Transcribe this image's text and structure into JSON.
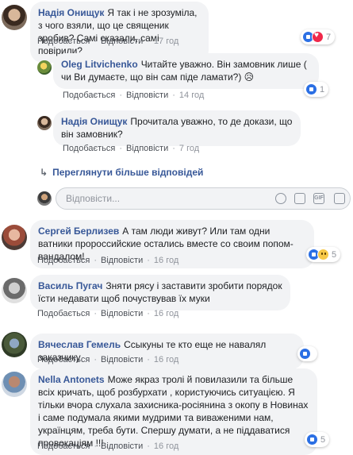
{
  "action_labels": {
    "like": "Подобається",
    "reply": "Відповісти"
  },
  "comments": [
    {
      "author": "Надія Онищук",
      "text": "Я так і не зрозуміла, з чого взяли, що це священик зробив? Самі сказали, самі повірили?",
      "time": "17 год",
      "reactions": [
        "like-icon",
        "love-icon"
      ],
      "reaction_count": "7"
    },
    {
      "author": "Oleg Litvichenko",
      "text": "Читайте уважно. Він замовник лише ( чи Ви думаєте, що він сам піде ламати?) 😥",
      "time": "14 год",
      "reactions": [
        "like-icon"
      ],
      "reaction_count": "1"
    },
    {
      "author": "Надія Онищук",
      "text": "Прочитала уважно, то де докази, що він замовник?",
      "time": "7 год"
    },
    {
      "author": "Сергей Берлизев",
      "text": "А там люди живут? Или там одни ватники пророссийские остались вместе со своим попом- вандалом!",
      "time": "16 год",
      "reactions": [
        "like-icon",
        "wow-icon"
      ],
      "reaction_count": "5"
    },
    {
      "author": "Василь Пугач",
      "text": "Зняти рясу і заставити зробити порядок їсти недавати щоб почуствував їх муки",
      "time": "16 год"
    },
    {
      "author": "Вячеслав Гемель",
      "text": "Ссыкуны те кто еще не навалял заказчику",
      "time": "16 год",
      "reactions": [
        "like-icon"
      ],
      "reaction_count": ""
    },
    {
      "author": "Nella Antonets",
      "text": "Може якраз тролі й повилазили та більше всіх кричать, щоб розбурхати , користуючись ситуацією. Я тільки вчора слухала захисника-росіянина з окопу в Новинах і саме подумала якими мудрими та виваженими нам, українцям, треба бути. Спершу думати, а не піддаватися провокаціям !!!",
      "time": "16 год",
      "reactions": [
        "like-icon"
      ],
      "reaction_count": "5"
    }
  ],
  "more_replies": "Переглянути більше відповідей",
  "reply_input": {
    "placeholder": "Відповісти...",
    "icons": [
      "emoji-icon",
      "camera-icon",
      "gif-icon",
      "sticker-icon"
    ]
  },
  "colors": {
    "author": "#385898",
    "bubble": "#f2f3f5",
    "meta": "#90949c",
    "like": "#2b6fe4",
    "love": "#f0284a",
    "wow": "#f7c948"
  }
}
